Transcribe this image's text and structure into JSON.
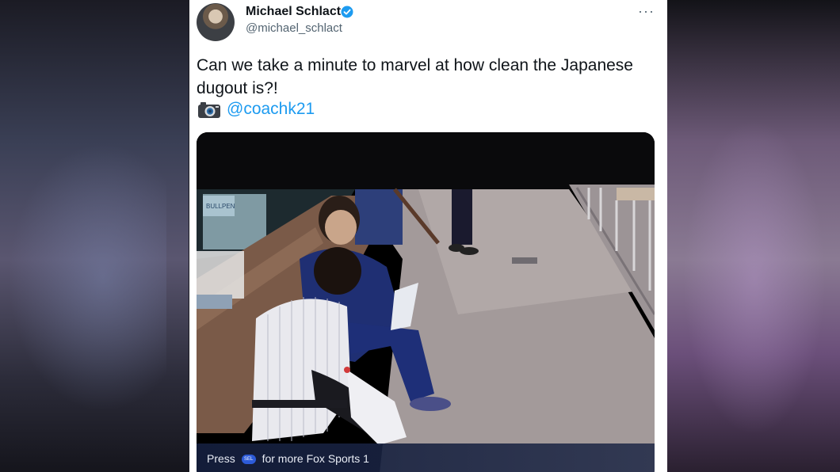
{
  "tweet": {
    "author_name": "Michael Schlact",
    "author_handle": "@michael_schlact",
    "more_menu": "···",
    "text": "Can we take a minute to marvel at how clean the Japanese dugout is?!",
    "mention": "@coachk21"
  },
  "media": {
    "sign_label": "BULLPEN",
    "overlay_prefix": "Press",
    "overlay_chip": "SEL",
    "overlay_suffix": "for more Fox Sports 1"
  },
  "colors": {
    "link": "#1d9bf0",
    "verified": "#1d9bf0",
    "text": "#0f1419",
    "secondary": "#536471"
  }
}
